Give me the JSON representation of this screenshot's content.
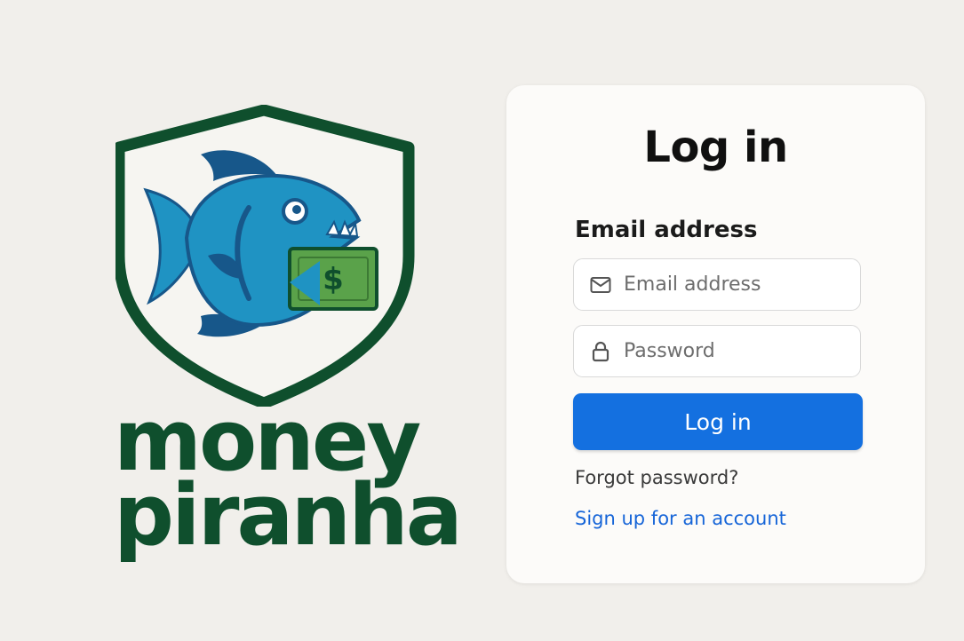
{
  "brand": {
    "name_line1": "money",
    "name_line2": "piranha",
    "logo_icon": "piranha-with-dollar-shield-icon",
    "colors": {
      "shield": "#0f4f2d",
      "fish_body": "#1f93c3",
      "fish_dark": "#17578a",
      "bill": "#5aa24a"
    }
  },
  "login": {
    "title": "Log in",
    "email_label": "Email address",
    "email_placeholder": "Email address",
    "email_value": "",
    "email_icon": "envelope-icon",
    "password_placeholder": "Password",
    "password_value": "",
    "password_icon": "lock-icon",
    "submit_label": "Log in",
    "forgot_label": "Forgot password?",
    "signup_label": "Sign up for an account"
  },
  "colors": {
    "background": "#f1efeb",
    "card": "#fcfbf9",
    "primary": "#1470e0",
    "link": "#1665d8"
  }
}
